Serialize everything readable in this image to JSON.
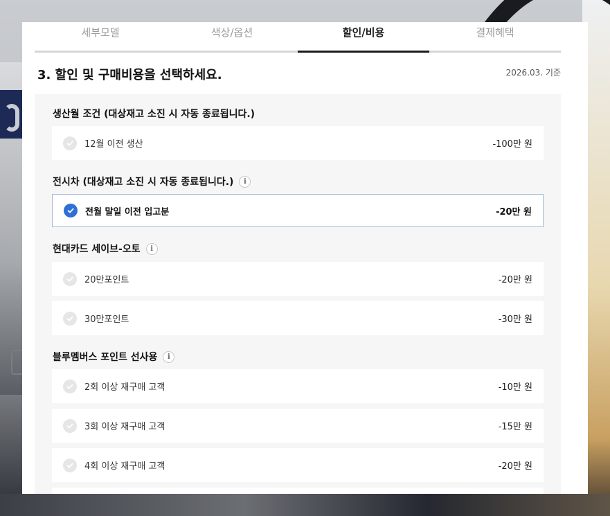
{
  "tabs": [
    {
      "label": "세부모델",
      "active": false
    },
    {
      "label": "색상/옵션",
      "active": false
    },
    {
      "label": "할인/비용",
      "active": true
    },
    {
      "label": "결제혜택",
      "active": false
    }
  ],
  "heading": "3. 할인 및 구매비용을 선택하세요.",
  "basis": "2026.03. 기준",
  "groups": [
    {
      "title": "생산월 조건 (대상재고 소진 시 자동 종료됩니다.)",
      "info": false,
      "options": [
        {
          "label": "12월 이전 생산",
          "price": "-100만 원",
          "selected": false
        }
      ]
    },
    {
      "title": "전시차 (대상재고 소진 시 자동 종료됩니다.)",
      "info": true,
      "options": [
        {
          "label": "전월 말일 이전 입고분",
          "price": "-20만 원",
          "selected": true
        }
      ]
    },
    {
      "title": "현대카드 세이브-오토",
      "info": true,
      "options": [
        {
          "label": "20만포인트",
          "price": "-20만 원",
          "selected": false
        },
        {
          "label": "30만포인트",
          "price": "-30만 원",
          "selected": false
        }
      ]
    },
    {
      "title": "블루멤버스 포인트 선사용",
      "info": true,
      "options": [
        {
          "label": "2회 이상 재구매 고객",
          "price": "-10만 원",
          "selected": false
        },
        {
          "label": "3회 이상 재구매 고객",
          "price": "-15만 원",
          "selected": false
        },
        {
          "label": "4회 이상 재구매 고객",
          "price": "-20만 원",
          "selected": false
        }
      ]
    }
  ],
  "colors": {
    "accent": "#2f6fd6",
    "selected_border": "#9fb7d6",
    "section_bg": "#f6f6f6"
  },
  "icons": {
    "check": "check-icon",
    "info": "info-icon"
  }
}
